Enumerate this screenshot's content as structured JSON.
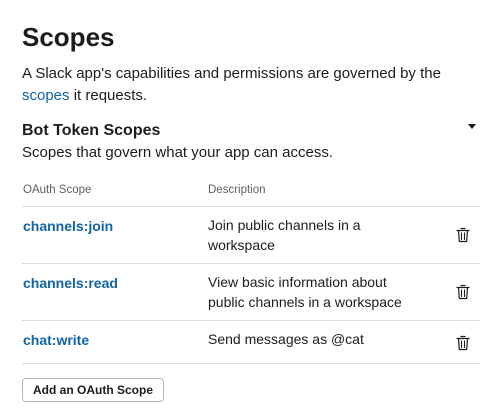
{
  "page": {
    "title": "Scopes",
    "intro_before_link": "A Slack app's capabilities and permissions are governed by the ",
    "intro_link": "scopes",
    "intro_after_link": " it requests."
  },
  "bot_scopes": {
    "title": "Bot Token Scopes",
    "subtitle": "Scopes that govern what your app can access.",
    "columns": {
      "scope": "OAuth Scope",
      "description": "Description"
    },
    "rows": [
      {
        "scope": "channels:join",
        "description": "Join public channels in a workspace"
      },
      {
        "scope": "channels:read",
        "description": "View basic information about public channels in a workspace"
      },
      {
        "scope": "chat:write",
        "description": "Send messages as @cat"
      }
    ],
    "add_button_label": "Add an OAuth Scope"
  },
  "colors": {
    "link": "#1264a3",
    "text": "#1d1c1d",
    "muted": "#616061",
    "divider": "#dddddd"
  },
  "icons": {
    "row_action": "trash-icon",
    "section_toggle": "caret-down-icon"
  }
}
